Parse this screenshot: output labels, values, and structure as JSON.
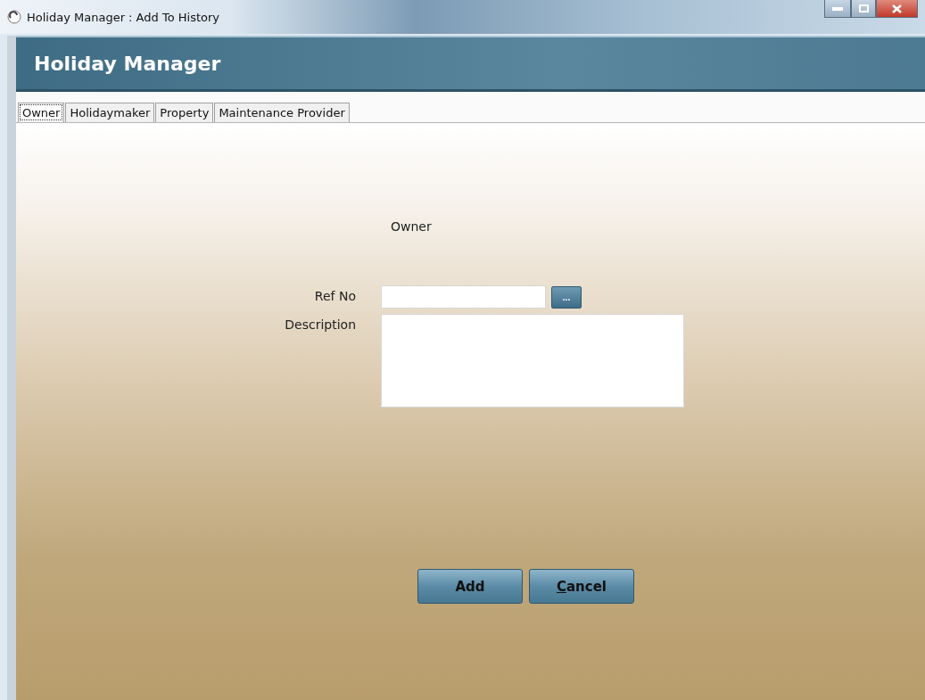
{
  "window": {
    "title": "Holiday Manager : Add To History"
  },
  "header": {
    "title": "Holiday Manager"
  },
  "tabs": [
    {
      "label": "Owner",
      "selected": true
    },
    {
      "label": "Holidaymaker",
      "selected": false
    },
    {
      "label": "Property",
      "selected": false
    },
    {
      "label": "Maintenance Provider",
      "selected": false
    }
  ],
  "form": {
    "heading": "Owner",
    "fields": [
      {
        "kind": "lookup",
        "label": "Ref No",
        "button": "..."
      },
      {
        "kind": "multiline",
        "label": "Description"
      }
    ]
  },
  "buttons": [
    {
      "label": "Add",
      "mnemonic": false
    },
    {
      "label": "Cancel",
      "mnemonic": true
    }
  ]
}
